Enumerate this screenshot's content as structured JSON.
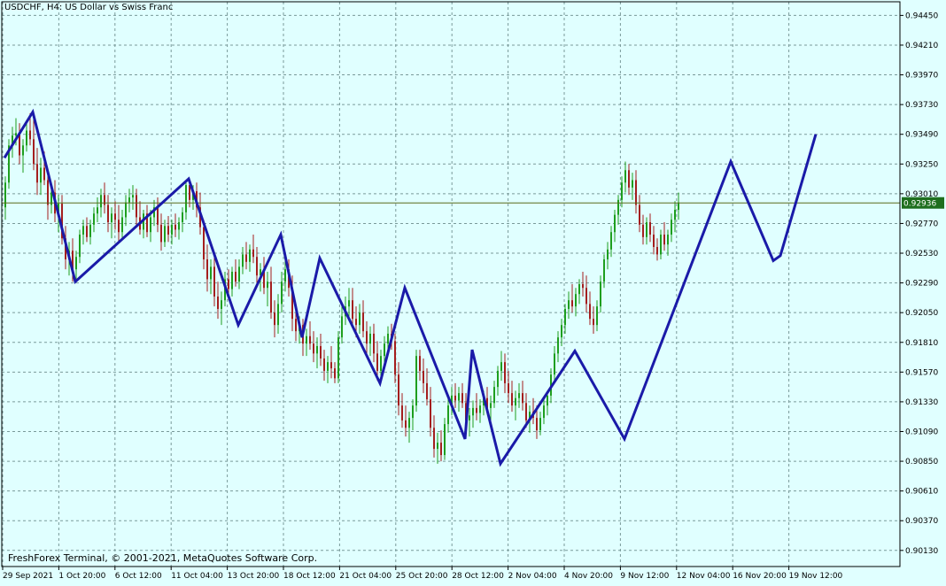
{
  "header": {
    "symbol_tf": "USDCHF, H4:",
    "description": "US Dollar vs Swiss Franc"
  },
  "footer": {
    "copyright": "FreshForex Terminal, © 2001-2021, MetaQuotes Software Corp."
  },
  "colors": {
    "background": "#E0FFFF",
    "grid": "#7A9A9A",
    "bull": "#1E9E1E",
    "bear": "#A41E1E",
    "zigzag": "#1A1AA8",
    "current_line": "#5A6A1A",
    "price_tag": "#1E6E1E"
  },
  "chart_data": {
    "type": "candlestick",
    "title": "",
    "y_ticks": [
      "0.94450",
      "0.94210",
      "0.93970",
      "0.93730",
      "0.93490",
      "0.93250",
      "0.93010",
      "0.92770",
      "0.92530",
      "0.92290",
      "0.92050",
      "0.91810",
      "0.91570",
      "0.91330",
      "0.91090",
      "0.90850",
      "0.90610",
      "0.90370",
      "0.90130"
    ],
    "x_ticks": [
      "29 Sep 2021",
      "1 Oct 20:00",
      "6 Oct 12:00",
      "11 Oct 04:00",
      "13 Oct 20:00",
      "18 Oct 12:00",
      "21 Oct 04:00",
      "25 Oct 20:00",
      "28 Oct 12:00",
      "2 Nov 04:00",
      "4 Nov 20:00",
      "9 Nov 12:00",
      "12 Nov 04:00",
      "16 Nov 20:00",
      "19 Nov 12:00"
    ],
    "current_price": "0.92936",
    "ylim": [
      0.9,
      0.9456
    ],
    "grid": true,
    "zigzag": [
      {
        "t": 0,
        "p": 0.933
      },
      {
        "t": 8,
        "p": 0.9367
      },
      {
        "t": 20,
        "p": 0.923
      },
      {
        "t": 52,
        "p": 0.9313
      },
      {
        "t": 66,
        "p": 0.9195
      },
      {
        "t": 78,
        "p": 0.9268
      },
      {
        "t": 84,
        "p": 0.9185
      },
      {
        "t": 89,
        "p": 0.9249
      },
      {
        "t": 106,
        "p": 0.9148
      },
      {
        "t": 113,
        "p": 0.9225
      },
      {
        "t": 130,
        "p": 0.9103
      },
      {
        "t": 132,
        "p": 0.9175
      },
      {
        "t": 140,
        "p": 0.9083
      },
      {
        "t": 161,
        "p": 0.9174
      },
      {
        "t": 175,
        "p": 0.9103
      },
      {
        "t": 205,
        "p": 0.9327
      },
      {
        "t": 217,
        "p": 0.9247
      },
      {
        "t": 219,
        "p": 0.9251
      },
      {
        "t": 229,
        "p": 0.9349
      }
    ],
    "candles": [
      [
        0.929,
        0.9315,
        0.928,
        0.931
      ],
      [
        0.931,
        0.9345,
        0.9305,
        0.934
      ],
      [
        0.934,
        0.9355,
        0.933,
        0.9348
      ],
      [
        0.9348,
        0.9362,
        0.934,
        0.935
      ],
      [
        0.935,
        0.9358,
        0.9325,
        0.9332
      ],
      [
        0.9332,
        0.9345,
        0.9318,
        0.934
      ],
      [
        0.934,
        0.936,
        0.9335,
        0.9352
      ],
      [
        0.9352,
        0.9366,
        0.934,
        0.9345
      ],
      [
        0.9345,
        0.9362,
        0.932,
        0.9325
      ],
      [
        0.9325,
        0.9338,
        0.93,
        0.931
      ],
      [
        0.931,
        0.933,
        0.93,
        0.9322
      ],
      [
        0.9322,
        0.9335,
        0.9308,
        0.9312
      ],
      [
        0.9312,
        0.932,
        0.928,
        0.9292
      ],
      [
        0.9292,
        0.931,
        0.9285,
        0.9302
      ],
      [
        0.9302,
        0.9312,
        0.9278,
        0.9285
      ],
      [
        0.9285,
        0.93,
        0.927,
        0.9293
      ],
      [
        0.9293,
        0.93,
        0.926,
        0.9265
      ],
      [
        0.9265,
        0.9275,
        0.924,
        0.9248
      ],
      [
        0.9248,
        0.9262,
        0.9235,
        0.9255
      ],
      [
        0.9255,
        0.9265,
        0.923,
        0.924
      ],
      [
        0.924,
        0.9255,
        0.9232,
        0.925
      ],
      [
        0.925,
        0.9272,
        0.9245,
        0.9268
      ],
      [
        0.9268,
        0.928,
        0.926,
        0.9275
      ],
      [
        0.9275,
        0.9282,
        0.9262,
        0.9266
      ],
      [
        0.9266,
        0.928,
        0.926,
        0.9276
      ],
      [
        0.9276,
        0.929,
        0.927,
        0.9285
      ],
      [
        0.9285,
        0.9298,
        0.9278,
        0.929
      ],
      [
        0.929,
        0.9305,
        0.9282,
        0.93
      ],
      [
        0.93,
        0.931,
        0.9285,
        0.9292
      ],
      [
        0.9292,
        0.93,
        0.927,
        0.9278
      ],
      [
        0.9278,
        0.929,
        0.9265,
        0.9285
      ],
      [
        0.9285,
        0.9295,
        0.9272,
        0.928
      ],
      [
        0.928,
        0.9292,
        0.9262,
        0.927
      ],
      [
        0.927,
        0.9288,
        0.9265,
        0.9282
      ],
      [
        0.9282,
        0.93,
        0.9275,
        0.9294
      ],
      [
        0.9294,
        0.9305,
        0.9286,
        0.9298
      ],
      [
        0.9298,
        0.9308,
        0.9288,
        0.93
      ],
      [
        0.93,
        0.9305,
        0.9276,
        0.9282
      ],
      [
        0.9282,
        0.9295,
        0.9268,
        0.9272
      ],
      [
        0.9272,
        0.9288,
        0.9265,
        0.9285
      ],
      [
        0.9285,
        0.9292,
        0.9266,
        0.927
      ],
      [
        0.927,
        0.9288,
        0.9262,
        0.9282
      ],
      [
        0.9282,
        0.9296,
        0.9275,
        0.929
      ],
      [
        0.929,
        0.9298,
        0.927,
        0.9276
      ],
      [
        0.9276,
        0.9285,
        0.9255,
        0.9262
      ],
      [
        0.9262,
        0.928,
        0.9258,
        0.9275
      ],
      [
        0.9275,
        0.9283,
        0.9262,
        0.9268
      ],
      [
        0.9268,
        0.928,
        0.926,
        0.9276
      ],
      [
        0.9276,
        0.9285,
        0.9266,
        0.9272
      ],
      [
        0.9272,
        0.9282,
        0.9264,
        0.9278
      ],
      [
        0.9278,
        0.929,
        0.927,
        0.9286
      ],
      [
        0.9286,
        0.9312,
        0.928,
        0.9308
      ],
      [
        0.9308,
        0.9313,
        0.929,
        0.9296
      ],
      [
        0.9296,
        0.9308,
        0.9288,
        0.9303
      ],
      [
        0.9303,
        0.931,
        0.9282,
        0.929
      ],
      [
        0.929,
        0.9302,
        0.9268,
        0.9274
      ],
      [
        0.9274,
        0.928,
        0.924,
        0.9248
      ],
      [
        0.9248,
        0.926,
        0.9222,
        0.9232
      ],
      [
        0.9232,
        0.9248,
        0.922,
        0.9242
      ],
      [
        0.9242,
        0.925,
        0.921,
        0.9218
      ],
      [
        0.9218,
        0.923,
        0.92,
        0.9208
      ],
      [
        0.9208,
        0.9222,
        0.9195,
        0.9215
      ],
      [
        0.9215,
        0.9238,
        0.921,
        0.9232
      ],
      [
        0.9232,
        0.924,
        0.9215,
        0.9224
      ],
      [
        0.9224,
        0.9242,
        0.9218,
        0.9238
      ],
      [
        0.9238,
        0.9248,
        0.9226,
        0.923
      ],
      [
        0.923,
        0.9248,
        0.9224,
        0.9242
      ],
      [
        0.9242,
        0.9258,
        0.9236,
        0.9252
      ],
      [
        0.9252,
        0.9262,
        0.924,
        0.9246
      ],
      [
        0.9246,
        0.926,
        0.9238,
        0.9256
      ],
      [
        0.9256,
        0.9268,
        0.9245,
        0.925
      ],
      [
        0.925,
        0.9258,
        0.9228,
        0.9235
      ],
      [
        0.9235,
        0.9245,
        0.9222,
        0.924
      ],
      [
        0.924,
        0.925,
        0.922,
        0.9225
      ],
      [
        0.9225,
        0.9238,
        0.921,
        0.923
      ],
      [
        0.923,
        0.9242,
        0.92,
        0.9205
      ],
      [
        0.9205,
        0.9215,
        0.9185,
        0.9195
      ],
      [
        0.9195,
        0.922,
        0.9188,
        0.9212
      ],
      [
        0.9212,
        0.9238,
        0.9205,
        0.923
      ],
      [
        0.923,
        0.9249,
        0.9222,
        0.924
      ],
      [
        0.924,
        0.9248,
        0.9218,
        0.9225
      ],
      [
        0.9225,
        0.9235,
        0.919,
        0.92
      ],
      [
        0.92,
        0.921,
        0.9182,
        0.919
      ],
      [
        0.919,
        0.9202,
        0.918,
        0.9195
      ],
      [
        0.9195,
        0.92,
        0.917,
        0.918
      ],
      [
        0.918,
        0.9192,
        0.917,
        0.9186
      ],
      [
        0.9186,
        0.9198,
        0.9175,
        0.918
      ],
      [
        0.918,
        0.919,
        0.9165,
        0.9172
      ],
      [
        0.9172,
        0.9185,
        0.916,
        0.9178
      ],
      [
        0.9178,
        0.9188,
        0.9162,
        0.9168
      ],
      [
        0.9168,
        0.9175,
        0.915,
        0.9158
      ],
      [
        0.9158,
        0.917,
        0.9148,
        0.9165
      ],
      [
        0.9165,
        0.9178,
        0.9152,
        0.916
      ],
      [
        0.916,
        0.9165,
        0.9148,
        0.9152
      ],
      [
        0.9152,
        0.919,
        0.9148,
        0.9185
      ],
      [
        0.9185,
        0.921,
        0.918,
        0.9202
      ],
      [
        0.9202,
        0.9218,
        0.9195,
        0.921
      ],
      [
        0.921,
        0.9225,
        0.92,
        0.9215
      ],
      [
        0.9215,
        0.9225,
        0.9195,
        0.92
      ],
      [
        0.92,
        0.921,
        0.9185,
        0.9195
      ],
      [
        0.9195,
        0.9212,
        0.9188,
        0.9205
      ],
      [
        0.9205,
        0.9215,
        0.9185,
        0.919
      ],
      [
        0.919,
        0.9198,
        0.9172,
        0.918
      ],
      [
        0.918,
        0.9194,
        0.917,
        0.9188
      ],
      [
        0.9188,
        0.9196,
        0.9165,
        0.9172
      ],
      [
        0.9172,
        0.9182,
        0.915,
        0.9158
      ],
      [
        0.9158,
        0.9175,
        0.9152,
        0.917
      ],
      [
        0.917,
        0.9186,
        0.9162,
        0.918
      ],
      [
        0.918,
        0.9194,
        0.9172,
        0.9188
      ],
      [
        0.9188,
        0.9196,
        0.9175,
        0.9182
      ],
      [
        0.9182,
        0.9188,
        0.9148,
        0.9155
      ],
      [
        0.9155,
        0.9165,
        0.9122,
        0.913
      ],
      [
        0.913,
        0.914,
        0.9112,
        0.9118
      ],
      [
        0.9118,
        0.913,
        0.9105,
        0.9112
      ],
      [
        0.9112,
        0.9125,
        0.91,
        0.912
      ],
      [
        0.912,
        0.9135,
        0.911,
        0.913
      ],
      [
        0.913,
        0.9175,
        0.9125,
        0.917
      ],
      [
        0.917,
        0.9175,
        0.915,
        0.9158
      ],
      [
        0.9158,
        0.9168,
        0.914,
        0.9148
      ],
      [
        0.9148,
        0.916,
        0.913,
        0.9135
      ],
      [
        0.9135,
        0.9145,
        0.9105,
        0.9112
      ],
      [
        0.9112,
        0.9122,
        0.9088,
        0.9095
      ],
      [
        0.9095,
        0.9108,
        0.9083,
        0.91
      ],
      [
        0.91,
        0.911,
        0.9085,
        0.909
      ],
      [
        0.909,
        0.912,
        0.9086,
        0.9115
      ],
      [
        0.9115,
        0.9135,
        0.9108,
        0.913
      ],
      [
        0.913,
        0.9145,
        0.9122,
        0.9138
      ],
      [
        0.9138,
        0.9148,
        0.9128,
        0.9134
      ],
      [
        0.9134,
        0.9145,
        0.9125,
        0.914
      ],
      [
        0.914,
        0.9148,
        0.9128,
        0.9132
      ],
      [
        0.9132,
        0.914,
        0.9112,
        0.9118
      ],
      [
        0.9118,
        0.9128,
        0.9105,
        0.9122
      ],
      [
        0.9122,
        0.9134,
        0.9112,
        0.9128
      ],
      [
        0.9128,
        0.914,
        0.9118,
        0.9124
      ],
      [
        0.9124,
        0.9135,
        0.9116,
        0.913
      ],
      [
        0.913,
        0.9142,
        0.9122,
        0.9136
      ],
      [
        0.9136,
        0.9145,
        0.9125,
        0.9128
      ],
      [
        0.9128,
        0.9138,
        0.9118,
        0.9132
      ],
      [
        0.9132,
        0.915,
        0.9128,
        0.9145
      ],
      [
        0.9145,
        0.9162,
        0.9138,
        0.9158
      ],
      [
        0.9158,
        0.9174,
        0.915,
        0.9165
      ],
      [
        0.9165,
        0.9172,
        0.914,
        0.9148
      ],
      [
        0.9148,
        0.9158,
        0.9132,
        0.914
      ],
      [
        0.914,
        0.915,
        0.9125,
        0.913
      ],
      [
        0.913,
        0.9142,
        0.9118,
        0.9136
      ],
      [
        0.9136,
        0.9148,
        0.9128,
        0.914
      ],
      [
        0.914,
        0.915,
        0.9126,
        0.9132
      ],
      [
        0.9132,
        0.914,
        0.9112,
        0.9118
      ],
      [
        0.9118,
        0.913,
        0.9108,
        0.9125
      ],
      [
        0.9125,
        0.9136,
        0.9115,
        0.912
      ],
      [
        0.912,
        0.913,
        0.9103,
        0.911
      ],
      [
        0.911,
        0.9125,
        0.9106,
        0.912
      ],
      [
        0.912,
        0.9135,
        0.9115,
        0.913
      ],
      [
        0.913,
        0.9142,
        0.9122,
        0.9138
      ],
      [
        0.9138,
        0.916,
        0.9132,
        0.9155
      ],
      [
        0.9155,
        0.9178,
        0.915,
        0.9172
      ],
      [
        0.9172,
        0.919,
        0.9165,
        0.9185
      ],
      [
        0.9185,
        0.92,
        0.9178,
        0.9195
      ],
      [
        0.9195,
        0.9212,
        0.9188,
        0.9208
      ],
      [
        0.9208,
        0.9222,
        0.92,
        0.9215
      ],
      [
        0.9215,
        0.9228,
        0.9205,
        0.921
      ],
      [
        0.921,
        0.9225,
        0.9202,
        0.922
      ],
      [
        0.922,
        0.9232,
        0.9212,
        0.9228
      ],
      [
        0.9228,
        0.9238,
        0.9218,
        0.9225
      ],
      [
        0.9225,
        0.9235,
        0.9205,
        0.9212
      ],
      [
        0.9212,
        0.9222,
        0.9195,
        0.92
      ],
      [
        0.92,
        0.921,
        0.9188,
        0.9195
      ],
      [
        0.9195,
        0.9215,
        0.919,
        0.921
      ],
      [
        0.921,
        0.9235,
        0.9205,
        0.923
      ],
      [
        0.923,
        0.9252,
        0.9225,
        0.9248
      ],
      [
        0.9248,
        0.9262,
        0.924,
        0.9256
      ],
      [
        0.9256,
        0.9275,
        0.925,
        0.927
      ],
      [
        0.927,
        0.9288,
        0.9262,
        0.9284
      ],
      [
        0.9284,
        0.93,
        0.9276,
        0.9296
      ],
      [
        0.9296,
        0.9315,
        0.929,
        0.931
      ],
      [
        0.931,
        0.9327,
        0.9302,
        0.932
      ],
      [
        0.932,
        0.9325,
        0.93,
        0.9306
      ],
      [
        0.9306,
        0.9318,
        0.9296,
        0.9312
      ],
      [
        0.9312,
        0.932,
        0.9285,
        0.9292
      ],
      [
        0.9292,
        0.93,
        0.927,
        0.9276
      ],
      [
        0.9276,
        0.9284,
        0.926,
        0.9266
      ],
      [
        0.9266,
        0.9282,
        0.926,
        0.9278
      ],
      [
        0.9278,
        0.9285,
        0.9262,
        0.9268
      ],
      [
        0.9268,
        0.9275,
        0.9252,
        0.9258
      ],
      [
        0.9258,
        0.9265,
        0.9247,
        0.9252
      ],
      [
        0.9252,
        0.9272,
        0.9248,
        0.9268
      ],
      [
        0.9268,
        0.9278,
        0.9255,
        0.926
      ],
      [
        0.926,
        0.9272,
        0.9251,
        0.9268
      ],
      [
        0.9268,
        0.9285,
        0.9262,
        0.928
      ],
      [
        0.928,
        0.9295,
        0.927,
        0.9288
      ],
      [
        0.9288,
        0.9302,
        0.928,
        0.9294
      ]
    ]
  }
}
